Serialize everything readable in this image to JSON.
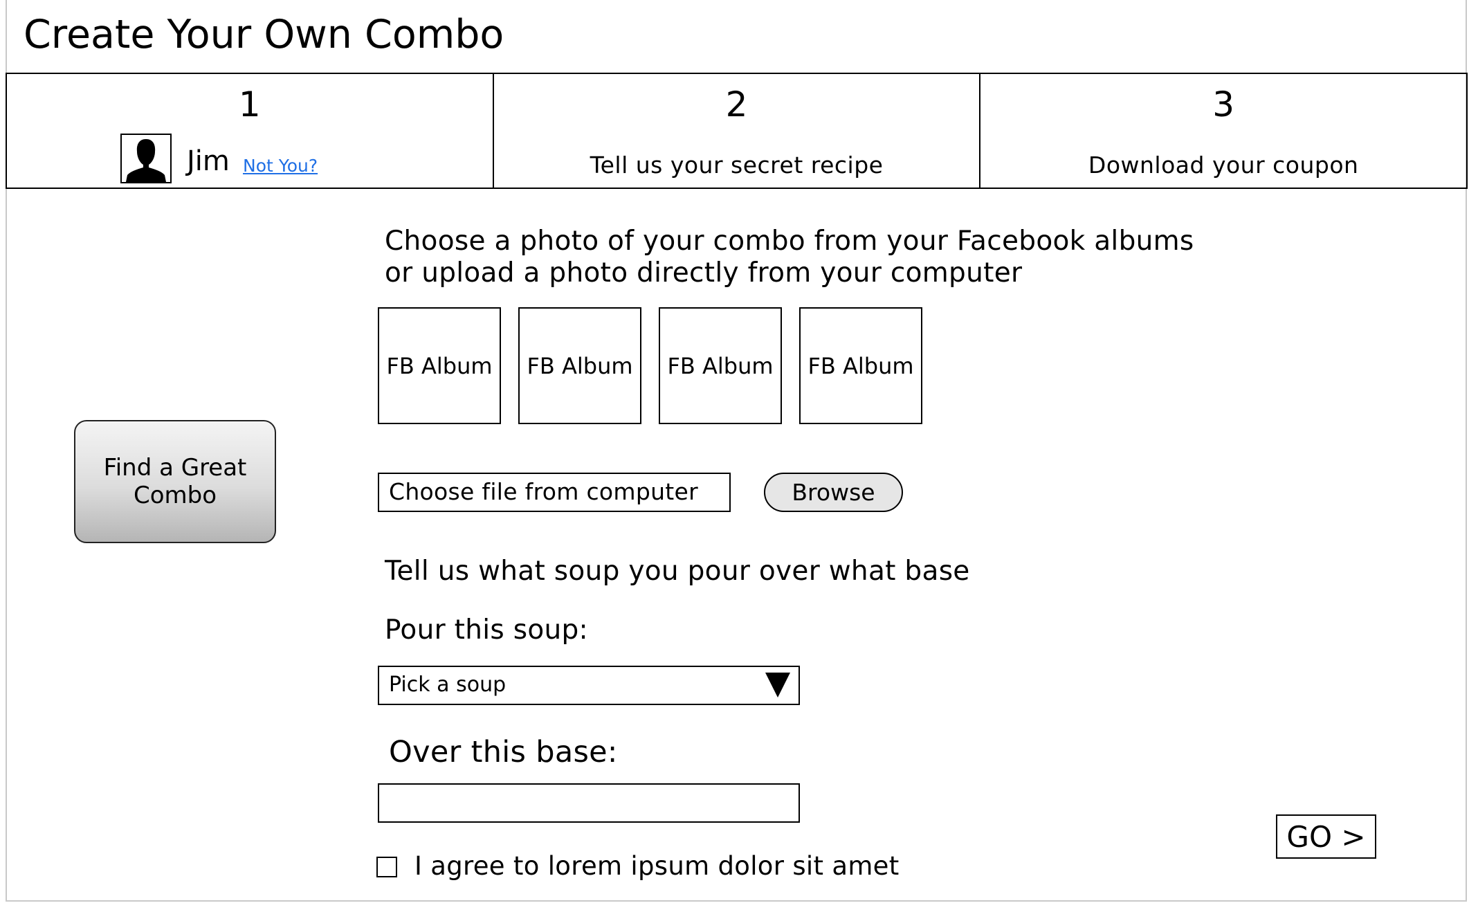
{
  "page": {
    "title": "Create Your Own Combo"
  },
  "steps": [
    {
      "number": "1",
      "user_name": "Jim",
      "not_you_link": "Not You?"
    },
    {
      "number": "2",
      "label": "Tell us your secret recipe"
    },
    {
      "number": "3",
      "label": "Download your coupon"
    }
  ],
  "sidebar": {
    "find_combo_label": "Find a Great Combo"
  },
  "photo": {
    "instructions": "Choose a photo of your combo from your Facebook albums or upload a photo directly from your computer",
    "albums": [
      "FB Album",
      "FB Album",
      "FB Album",
      "FB Album"
    ],
    "file_input_value": "Choose file from computer",
    "browse_label": "Browse"
  },
  "recipe": {
    "heading": "Tell us what soup you pour over what base",
    "soup_label": "Pour this soup:",
    "soup_selected": "Pick a soup",
    "base_label": "Over this base:",
    "base_value": ""
  },
  "agreement": {
    "label": "I agree to lorem ipsum dolor sit amet",
    "checked": false
  },
  "actions": {
    "go_label": "GO >"
  },
  "icons": {
    "avatar": "user-silhouette-icon",
    "dropdown": "triangle-down-icon"
  },
  "colors": {
    "link": "#1f6fe5",
    "button_gradient_top": "#f4f4f4",
    "button_gradient_bottom": "#b5b5b5",
    "frame_border": "#c9c9c9"
  }
}
